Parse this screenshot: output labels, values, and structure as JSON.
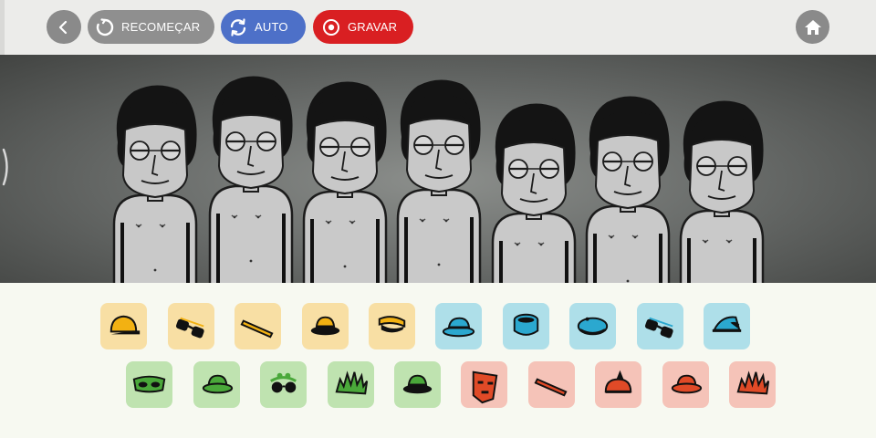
{
  "toolbar": {
    "back": {
      "icon": "chevron-left-icon"
    },
    "restart": {
      "label": "RECOMEÇAR",
      "icon": "restart-icon",
      "color": "#8f8f8f"
    },
    "auto": {
      "label": "AUTO",
      "icon": "refresh-icon",
      "color": "#4d70c8"
    },
    "record": {
      "label": "GRAVAR",
      "icon": "record-icon",
      "color": "#d91f22"
    },
    "home": {
      "icon": "home-icon"
    }
  },
  "stage": {
    "performers": [
      {
        "slot": 1,
        "state": "idle"
      },
      {
        "slot": 2,
        "state": "idle"
      },
      {
        "slot": 3,
        "state": "idle"
      },
      {
        "slot": 4,
        "state": "idle"
      },
      {
        "slot": 5,
        "state": "idle"
      },
      {
        "slot": 6,
        "state": "idle"
      },
      {
        "slot": 7,
        "state": "idle"
      }
    ]
  },
  "sound_categories": {
    "beats": {
      "color": "#f8dfa4",
      "icons": [
        "cap",
        "sunglasses",
        "headband",
        "fedora",
        "visor"
      ]
    },
    "effects": {
      "color": "#aedfe9",
      "icons": [
        "bowler-hat",
        "drum-hat",
        "beret",
        "sunglasses",
        "cap-side"
      ]
    },
    "melodies": {
      "color": "#bfe3b0",
      "icons": [
        "mask",
        "hat",
        "round-glasses",
        "spiky-hair",
        "fedora"
      ]
    },
    "voices": {
      "color": "#f5c3b8",
      "icons": [
        "tiki-mask",
        "headband",
        "crest-helmet",
        "hat",
        "spiky-hair"
      ]
    }
  }
}
